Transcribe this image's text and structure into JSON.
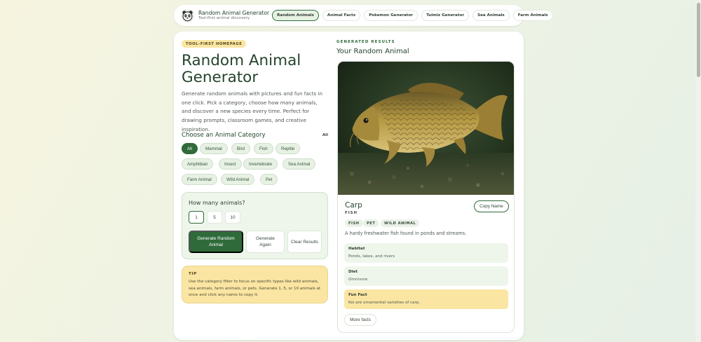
{
  "brand": {
    "title": "Random Animal Generator",
    "subtitle": "Tool-first animal discovery"
  },
  "nav": [
    "Random Animals",
    "Animal Facts",
    "Pokemon Generator",
    "Tuimiz Generator",
    "Sea Animals",
    "Farm Animals"
  ],
  "nav_active": "Random Animals",
  "hero": {
    "badge": "TOOL-FIRST HOMEPAGE",
    "title": "Random Animal Generator",
    "intro": "Generate random animals with pictures and fun facts in one click. Pick a category, choose how many animals, and discover a new species every time. Perfect for drawing prompts, classroom games, and creative inspiration."
  },
  "categories": {
    "heading": "Choose an Animal Category",
    "current": "All",
    "items": [
      "All",
      "Mammal",
      "Bird",
      "Fish",
      "Reptile",
      "Amphibian",
      "Insect",
      "Invertebrate",
      "Sea Animal",
      "Farm Animal",
      "Wild Animal",
      "Pet"
    ],
    "selected": "All"
  },
  "count": {
    "label": "How many animals?",
    "options": [
      "1",
      "5",
      "10"
    ],
    "selected": "1"
  },
  "actions": {
    "generate": "Generate Random Animal",
    "again": "Generate Again",
    "clear": "Clear Results"
  },
  "tip": {
    "title": "TIP",
    "text": "Use the category filter to focus on specific types like wild animals, sea animals, farm animals, or pets. Generate 1, 5, or 10 animals at once and click any name to copy it."
  },
  "results": {
    "eyebrow": "GENERATED RESULTS",
    "title": "Your Random Animal"
  },
  "animal": {
    "name": "Carp",
    "class": "FISH",
    "copy_label": "Copy Name",
    "tags": [
      "FISH",
      "PET",
      "WILD ANIMAL"
    ],
    "description": "A hardy freshwater fish found in ponds and streams.",
    "habitat_label": "Habitat",
    "habitat": "Ponds, lakes, and rivers",
    "diet_label": "Diet",
    "diet": "Omnivore",
    "fun_fact_label": "Fun Fact",
    "fun_fact": "Koi are ornamental varieties of carp.",
    "more_label": "More facts"
  },
  "colors": {
    "accent": "#2f6b3a",
    "accent_light": "#e7f1e4",
    "highlight": "#fae5a2",
    "title": "#24432c"
  }
}
